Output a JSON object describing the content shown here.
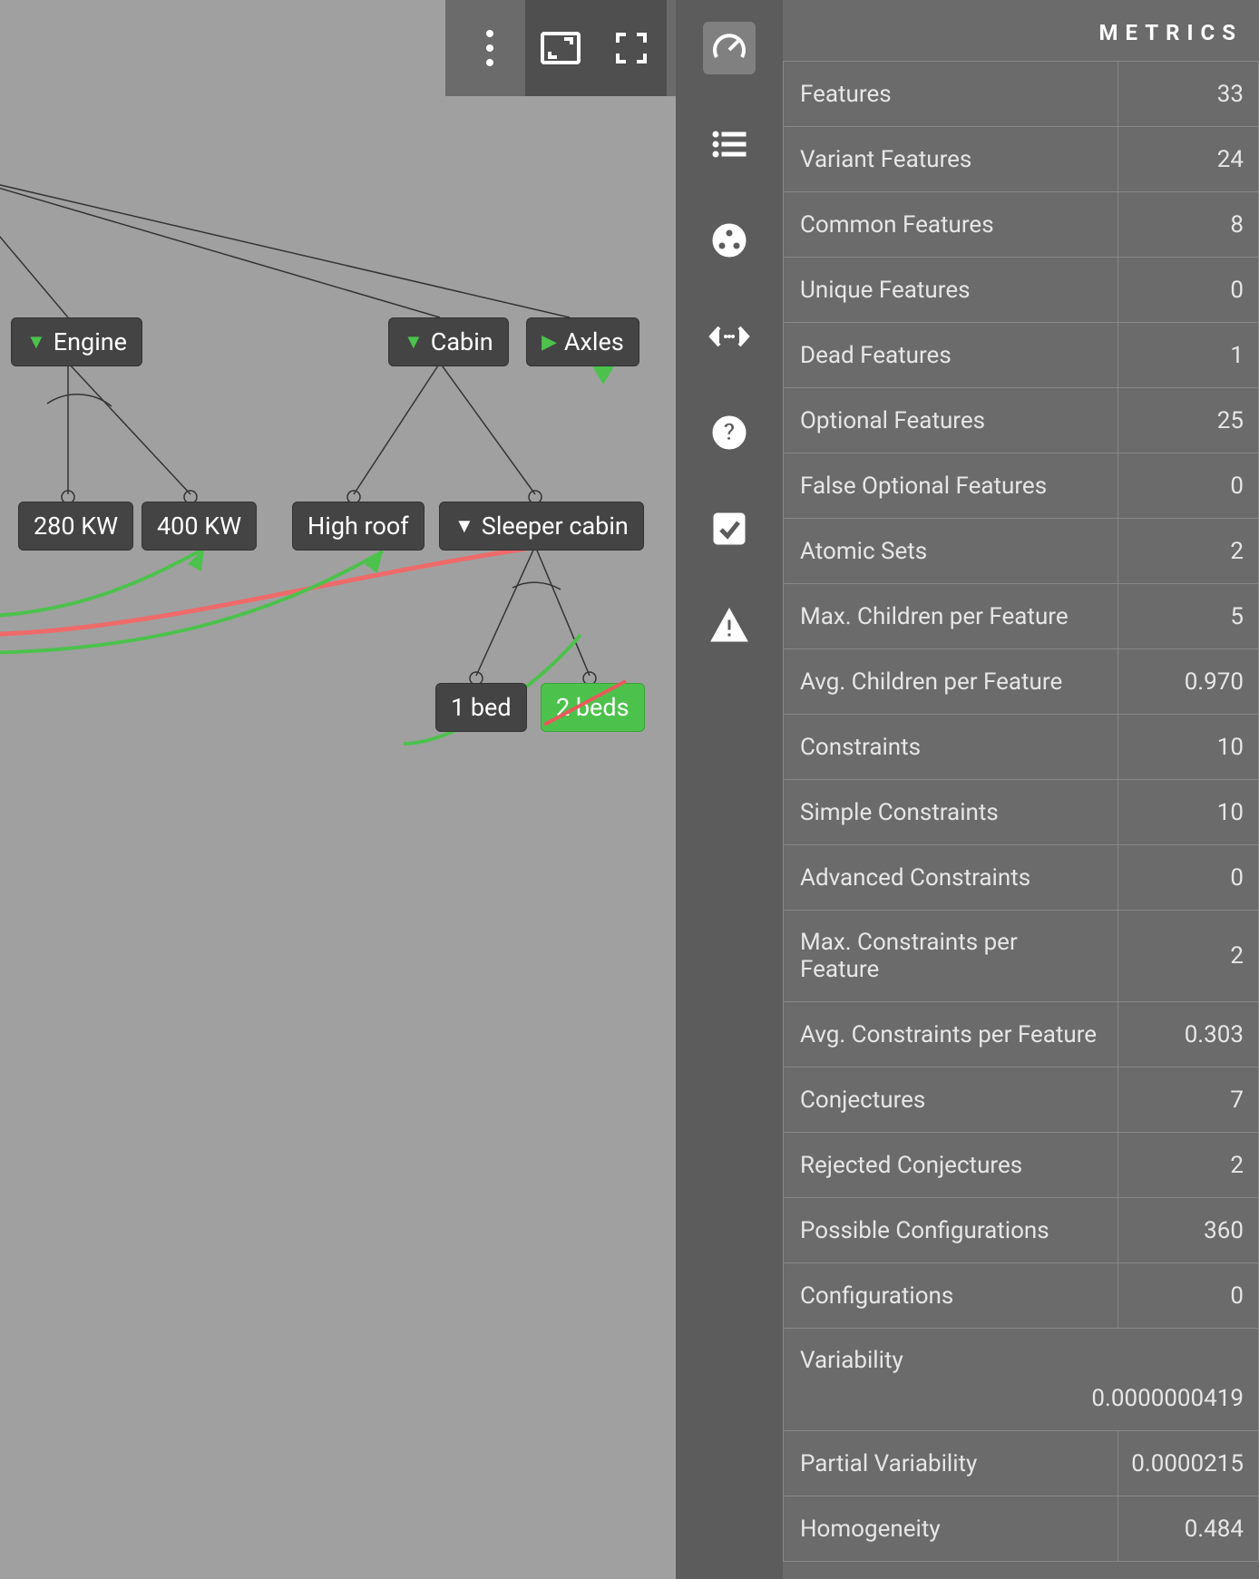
{
  "panel": {
    "title": "METRICS",
    "rows": [
      {
        "label": "Features",
        "value": "33"
      },
      {
        "label": "Variant Features",
        "value": "24"
      },
      {
        "label": "Common Features",
        "value": "8"
      },
      {
        "label": "Unique Features",
        "value": "0"
      },
      {
        "label": "Dead Features",
        "value": "1"
      },
      {
        "label": "Optional Features",
        "value": "25"
      },
      {
        "label": "False Optional Features",
        "value": "0"
      },
      {
        "label": "Atomic Sets",
        "value": "2"
      },
      {
        "label": "Max. Children per Feature",
        "value": "5"
      },
      {
        "label": "Avg. Children per Feature",
        "value": "0.970"
      },
      {
        "label": "Constraints",
        "value": "10"
      },
      {
        "label": "Simple Constraints",
        "value": "10"
      },
      {
        "label": "Advanced Constraints",
        "value": "0"
      },
      {
        "label": "Max. Constraints per Feature",
        "value": "2"
      },
      {
        "label": "Avg. Constraints per Feature",
        "value": "0.303"
      },
      {
        "label": "Conjectures",
        "value": "7"
      },
      {
        "label": "Rejected Conjectures",
        "value": "2"
      },
      {
        "label": "Possible Configurations",
        "value": "360"
      },
      {
        "label": "Configurations",
        "value": "0"
      }
    ],
    "tallRow": {
      "label": "Variability",
      "value": "0.0000000419"
    },
    "rows2": [
      {
        "label": "Partial Variability",
        "value": "0.0000215"
      },
      {
        "label": "Homogeneity",
        "value": "0.484"
      }
    ]
  },
  "tree": {
    "nodes": {
      "engine": "Engine",
      "cabin": "Cabin",
      "axles": "Axles",
      "kw280": "280 KW",
      "kw400": "400 KW",
      "highroof": "High roof",
      "sleeper": "Sleeper cabin",
      "bed1": "1 bed",
      "bed2": "2 beds"
    }
  },
  "rail": {
    "icons": [
      "gauge-icon",
      "list-icon",
      "share-icon",
      "code-icon",
      "help-icon",
      "check-icon",
      "warning-icon"
    ]
  },
  "toolbar": {
    "icons": [
      "dots-icon",
      "aspect-icon",
      "fullscreen-icon"
    ]
  }
}
